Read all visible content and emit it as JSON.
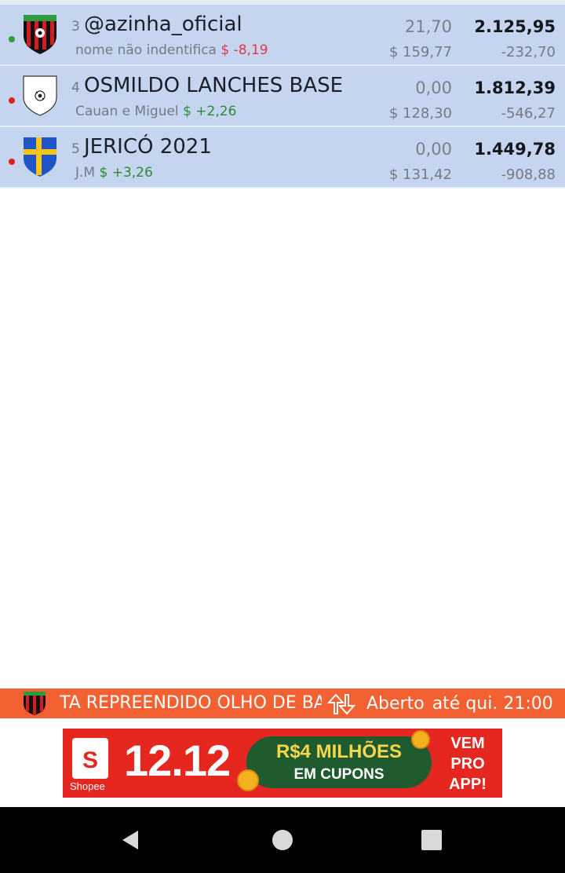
{
  "teams": [
    {
      "rank": "3",
      "name": "@azinha_oficial",
      "owner": "nome não indentifica",
      "delta": "$ -8,19",
      "delta_sign": "neg",
      "points": "21,70",
      "price": "$ 159,77",
      "total": "2.125,95",
      "diff": "-232,70",
      "status_color": "#2e9e3a",
      "shield": "red-black-stripes"
    },
    {
      "rank": "4",
      "name": "OSMILDO LANCHES BASE",
      "owner": "Cauan e Miguel",
      "delta": "$ +2,26",
      "delta_sign": "pos",
      "points": "0,00",
      "price": "$ 128,30",
      "total": "1.812,39",
      "diff": "-546,27",
      "status_color": "#e02020",
      "shield": "white-ball"
    },
    {
      "rank": "5",
      "name": "JERICÓ 2021",
      "owner": "J.M",
      "delta": "$ +3,26",
      "delta_sign": "pos",
      "points": "0,00",
      "price": "$ 131,42",
      "total": "1.449,78",
      "diff": "-908,88",
      "status_color": "#e02020",
      "shield": "blue-yellow-cross"
    }
  ],
  "banner": {
    "text": "TA REPREENDIDO OLHO DE BA",
    "status": "Aberto",
    "closing": "até qui. 21:00",
    "bg_color": "#f36133"
  },
  "ad": {
    "brand": "Shopee",
    "brand_letter": "S",
    "date": "12.12",
    "line1": "R$4 MILHÕES",
    "line2": "EM CUPONS",
    "cta_lines": [
      "VEM",
      "PRO",
      "APP!"
    ]
  },
  "nav": {
    "back": "back-icon",
    "home": "home-icon",
    "recents": "recents-icon"
  }
}
